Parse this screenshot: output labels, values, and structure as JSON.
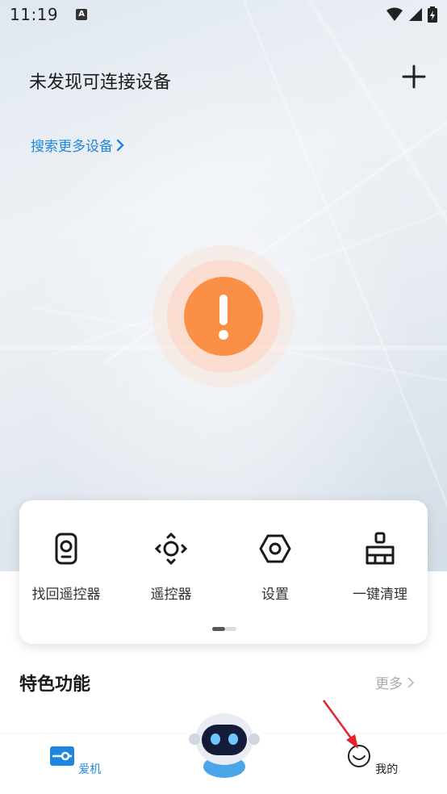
{
  "status_bar": {
    "time": "11:19",
    "notif_letter": "A",
    "icons": [
      "wifi-icon",
      "signal-icon",
      "battery-charging-icon"
    ]
  },
  "header": {
    "title": "未发现可连接设备",
    "add_icon": "plus-icon",
    "search_more": "搜索更多设备",
    "accent": "#1f86e0"
  },
  "status_indicator": {
    "icon": "exclamation-icon",
    "color": "#fb8f45"
  },
  "quick_actions": [
    {
      "label": "找回遥控器",
      "icon": "find-remote-icon"
    },
    {
      "label": "遥控器",
      "icon": "remote-control-icon"
    },
    {
      "label": "设置",
      "icon": "settings-hexagon-icon"
    },
    {
      "label": "一键清理",
      "icon": "broom-clean-icon"
    }
  ],
  "features": {
    "title": "特色功能",
    "more": "更多"
  },
  "bottom_nav": {
    "items": [
      {
        "label": "爱机",
        "icon": "device-icon",
        "active": true
      },
      {
        "label": "我的",
        "icon": "smile-profile-icon",
        "active": false
      }
    ],
    "center": "robot-mascot-icon",
    "active_color": "#1f86e0"
  }
}
